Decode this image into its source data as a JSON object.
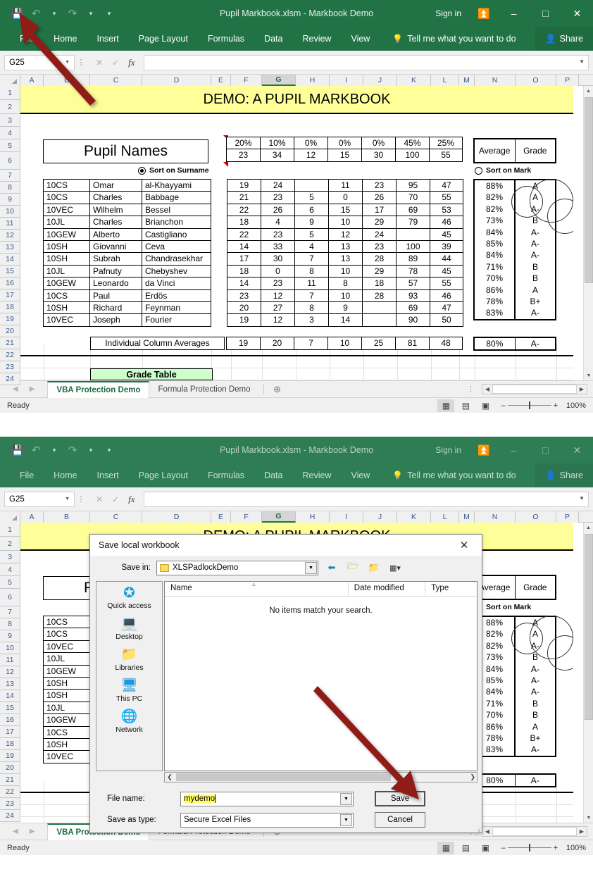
{
  "app": {
    "title": "Pupil Markbook.xlsm  -  Markbook Demo",
    "signin": "Sign in",
    "share": "Share",
    "tellme": "Tell me what you want to do",
    "tabs": [
      "File",
      "Home",
      "Insert",
      "Page Layout",
      "Formulas",
      "Data",
      "Review",
      "View"
    ],
    "namebox_value": "G25",
    "formula_value": ""
  },
  "grid": {
    "columns": [
      "A",
      "B",
      "C",
      "D",
      "E",
      "F",
      "G",
      "H",
      "I",
      "J",
      "K",
      "L",
      "M",
      "N",
      "O",
      "P"
    ],
    "selected_column": "G",
    "rows": [
      "1",
      "2",
      "3",
      "4",
      "5",
      "6",
      "7",
      "8",
      "9",
      "10",
      "11",
      "12",
      "13",
      "14",
      "15",
      "16",
      "17",
      "18",
      "19",
      "20",
      "21",
      "22",
      "23",
      "24"
    ]
  },
  "sheet": {
    "banner_title": "DEMO: A PUPIL MARKBOOK",
    "pupil_names_title": "Pupil Names",
    "sort_surname_label": "Sort on Surname",
    "sort_mark_label": "Sort on Mark",
    "average_header": "Average",
    "grade_header": "Grade",
    "averages_label": "Individual Column Averages",
    "grade_table_label": "Grade Table",
    "weights": [
      "20%",
      "10%",
      "0%",
      "0%",
      "0%",
      "45%",
      "25%"
    ],
    "totals": [
      "23",
      "34",
      "12",
      "15",
      "30",
      "100",
      "55"
    ],
    "pupils": [
      {
        "form": "10CS",
        "first": "Omar",
        "last": "al-Khayyami"
      },
      {
        "form": "10CS",
        "first": "Charles",
        "last": "Babbage"
      },
      {
        "form": "10VEC",
        "first": "Wilhelm",
        "last": "Bessel"
      },
      {
        "form": "10JL",
        "first": "Charles",
        "last": "Brianchon"
      },
      {
        "form": "10GEW",
        "first": "Alberto",
        "last": "Castigliano"
      },
      {
        "form": "10SH",
        "first": "Giovanni",
        "last": "Ceva"
      },
      {
        "form": "10SH",
        "first": "Subrah",
        "last": "Chandrasekhar"
      },
      {
        "form": "10JL",
        "first": "Pafnuty",
        "last": "Chebyshev"
      },
      {
        "form": "10GEW",
        "first": "Leonardo",
        "last": "da Vinci"
      },
      {
        "form": "10CS",
        "first": "Paul",
        "last": "Erdös"
      },
      {
        "form": "10SH",
        "first": "Richard",
        "last": "Feynman"
      },
      {
        "form": "10VEC",
        "first": "Joseph",
        "last": "Fourier"
      }
    ],
    "marks": [
      [
        "19",
        "24",
        "",
        "11",
        "23",
        "95",
        "47"
      ],
      [
        "21",
        "23",
        "5",
        "0",
        "26",
        "70",
        "55"
      ],
      [
        "22",
        "26",
        "6",
        "15",
        "17",
        "69",
        "53"
      ],
      [
        "18",
        "4",
        "9",
        "10",
        "29",
        "79",
        "46"
      ],
      [
        "22",
        "23",
        "5",
        "12",
        "24",
        "",
        "45"
      ],
      [
        "14",
        "33",
        "4",
        "13",
        "23",
        "100",
        "39"
      ],
      [
        "17",
        "30",
        "7",
        "13",
        "28",
        "89",
        "44"
      ],
      [
        "18",
        "0",
        "8",
        "10",
        "29",
        "78",
        "45"
      ],
      [
        "14",
        "23",
        "11",
        "8",
        "18",
        "57",
        "55"
      ],
      [
        "23",
        "12",
        "7",
        "10",
        "28",
        "93",
        "46"
      ],
      [
        "20",
        "27",
        "8",
        "9",
        "",
        "69",
        "47"
      ],
      [
        "19",
        "12",
        "3",
        "14",
        "",
        "90",
        "50"
      ]
    ],
    "averages": [
      "88%",
      "82%",
      "82%",
      "73%",
      "84%",
      "85%",
      "84%",
      "71%",
      "70%",
      "86%",
      "78%",
      "83%"
    ],
    "grades": [
      "A",
      "A",
      "A-",
      "B",
      "A-",
      "A-",
      "A-",
      "B",
      "B",
      "A",
      "B+",
      "A-"
    ],
    "column_averages": [
      "19",
      "20",
      "7",
      "10",
      "25",
      "81",
      "48"
    ],
    "overall_average": "80%",
    "overall_grade": "A-"
  },
  "sheettabs": {
    "tabs": [
      "VBA Protection Demo",
      "Formula Protection Demo"
    ],
    "active": "VBA Protection Demo"
  },
  "statusbar": {
    "state": "Ready",
    "zoom": "100%"
  },
  "dialog": {
    "title": "Save local workbook",
    "savein_label": "Save in:",
    "savein_value": "XLSPadlockDemo",
    "columns": [
      "Name",
      "Date modified",
      "Type"
    ],
    "empty_message": "No items match your search.",
    "places": [
      {
        "label": "Quick access",
        "icon": "star-icon"
      },
      {
        "label": "Desktop",
        "icon": "monitor-icon"
      },
      {
        "label": "Libraries",
        "icon": "libraries-icon"
      },
      {
        "label": "This PC",
        "icon": "pc-icon"
      },
      {
        "label": "Network",
        "icon": "network-icon"
      }
    ],
    "filename_label": "File name:",
    "filename_value": "mydemo",
    "filetype_label": "Save as type:",
    "filetype_value": "Secure Excel Files",
    "save_button": "Save",
    "cancel_button": "Cancel"
  },
  "colors": {
    "excel_green": "#217346",
    "banner_yellow": "#ffff99",
    "grade_green": "#ccffcc",
    "arrow_red": "#9c1a1a",
    "highlight_yellow": "#ffff66"
  }
}
